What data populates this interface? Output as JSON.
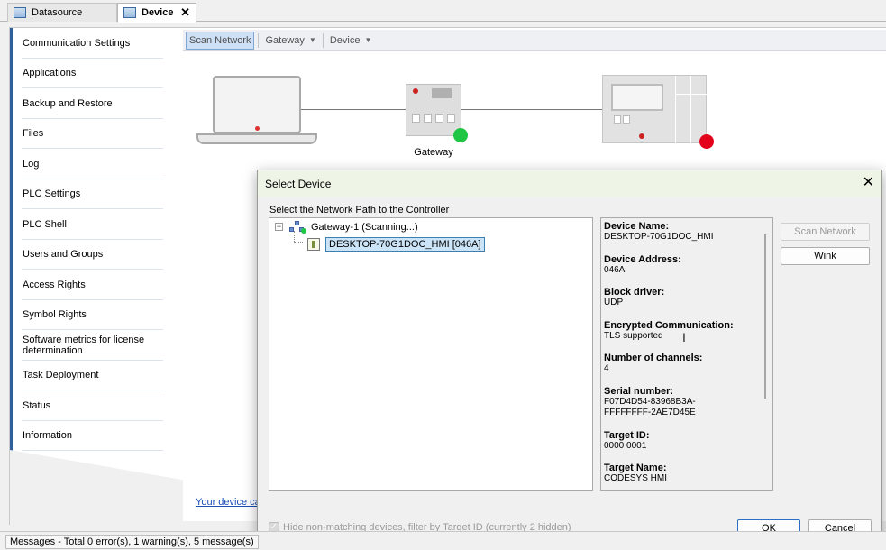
{
  "tabs": [
    {
      "label": "Datasource",
      "active": false
    },
    {
      "label": "Device",
      "active": true,
      "close": "✕"
    }
  ],
  "nav": {
    "items": [
      "Communication Settings",
      "Applications",
      "Backup and Restore",
      "Files",
      "Log",
      "PLC Settings",
      "PLC Shell",
      "Users and Groups",
      "Access Rights",
      "Symbol Rights",
      "Software metrics for license determination",
      "Task Deployment",
      "Status",
      "Information"
    ],
    "selected": 0
  },
  "toolbar": {
    "scan_network": "Scan Network",
    "gateway": "Gateway",
    "device": "Device"
  },
  "diagram": {
    "gateway_label": "Gateway",
    "gateway_status_color": "#1ec643",
    "plc_status_color": "#e3001b"
  },
  "main": {
    "link_text": "Your device ca"
  },
  "dialog": {
    "title": "Select Device",
    "close": "✕",
    "subtitle": "Select the Network Path to the Controller",
    "tree": {
      "gateway": "Gateway-1 (Scanning...)",
      "expander": "−",
      "device": "DESKTOP-70G1DOC_HMI [046A]"
    },
    "info": [
      {
        "label": "Device Name:",
        "value": "DESKTOP-70G1DOC_HMI"
      },
      {
        "label": "Device Address:",
        "value": "046A"
      },
      {
        "label": "Block driver:",
        "value": "UDP"
      },
      {
        "label": "Encrypted Communication:",
        "value": "TLS supported"
      },
      {
        "label": "Number of channels:",
        "value": "4"
      },
      {
        "label": "Serial number:",
        "value": "F07D4D54-83968B3A-\nFFFFFFFF-2AE7D45E"
      },
      {
        "label": "Target ID:",
        "value": "0000 0001"
      },
      {
        "label": "Target Name:",
        "value": "CODESYS HMI"
      }
    ],
    "buttons": {
      "scan_network": "Scan Network",
      "wink": "Wink",
      "ok": "OK",
      "cancel": "Cancel"
    },
    "filter_checkbox": {
      "label": "Hide non-matching devices, filter by Target ID (currently 2 hidden)",
      "checked": true
    }
  },
  "statusbar": {
    "messages": "Messages - Total 0 error(s), 1 warning(s), 5 message(s)"
  }
}
